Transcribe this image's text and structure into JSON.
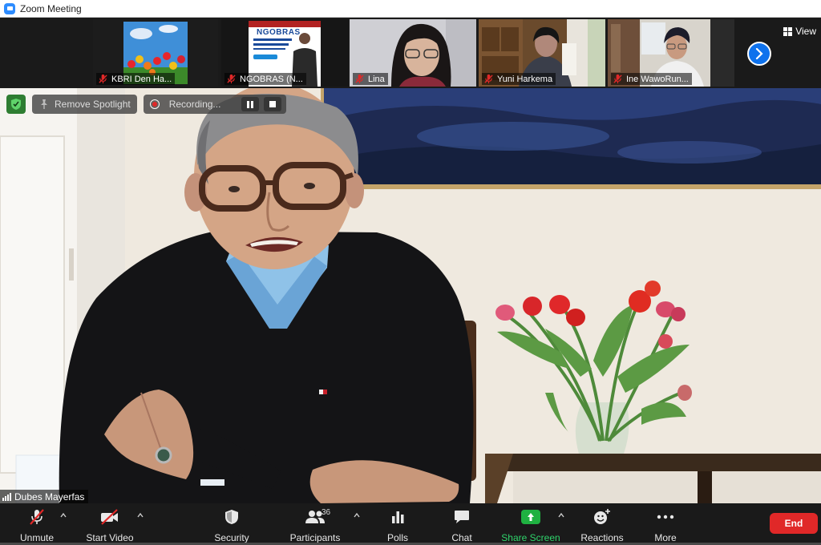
{
  "window": {
    "title": "Zoom Meeting"
  },
  "thumbnails": [
    {
      "name": "KBRI Den Ha..."
    },
    {
      "name": "NGOBRAS (N...",
      "poster_text": "NGOBRAS"
    },
    {
      "name": "Lina"
    },
    {
      "name": "Yuni Harkema"
    },
    {
      "name": "Ine WawoRun..."
    }
  ],
  "view_button": {
    "label": "View"
  },
  "overlay": {
    "spotlight_label": "Remove Spotlight",
    "recording_label": "Recording..."
  },
  "speaker": {
    "name": "Dubes Mayerfas"
  },
  "toolbar": {
    "unmute": "Unmute",
    "start_video": "Start Video",
    "security": "Security",
    "participants": "Participants",
    "participants_count": "36",
    "polls": "Polls",
    "chat": "Chat",
    "share_screen": "Share Screen",
    "reactions": "Reactions",
    "more": "More",
    "end": "End"
  },
  "colors": {
    "zoom_blue": "#2d8cff",
    "end_red": "#e02828",
    "share_green": "#1fb141",
    "security_green": "#2e7d32",
    "toolbar_bg": "#1a1a1a"
  },
  "icons": [
    "zoom-logo-icon",
    "muted-mic-icon",
    "grid-view-icon",
    "chevron-right-icon",
    "shield-icon",
    "pin-icon",
    "record-icon",
    "pause-icon",
    "stop-icon",
    "signal-icon",
    "mic-off-icon",
    "video-off-icon",
    "participants-icon",
    "polls-icon",
    "chat-icon",
    "share-screen-icon",
    "reactions-icon",
    "more-icon",
    "caret-up-icon"
  ]
}
